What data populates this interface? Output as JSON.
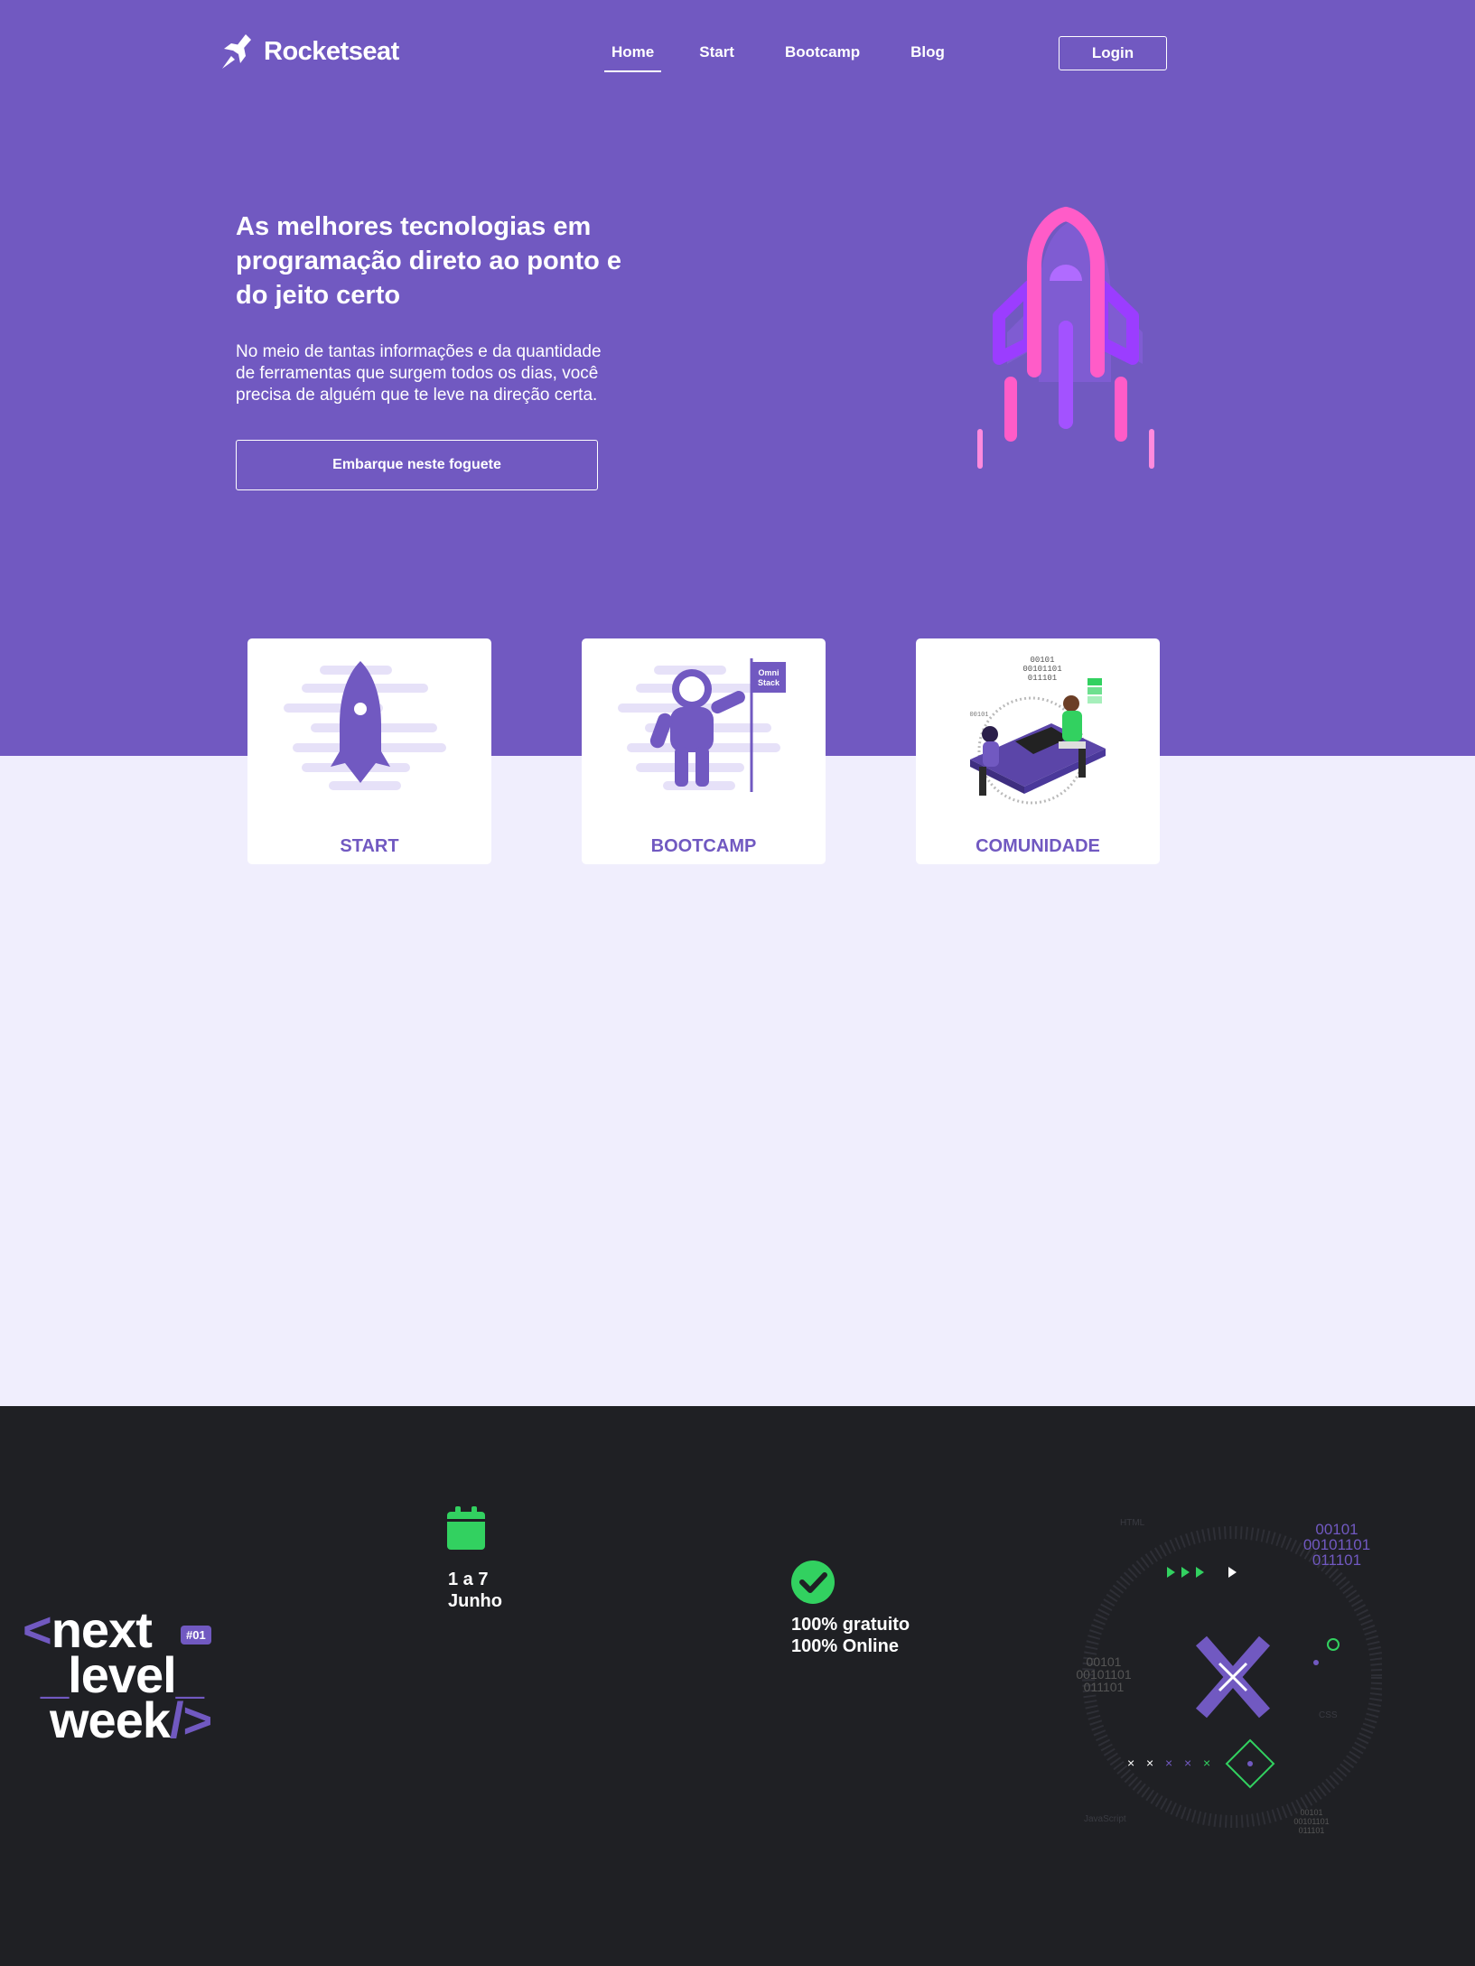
{
  "nav": {
    "brand": "Rocketseat",
    "links": [
      "Home",
      "Start",
      "Bootcamp",
      "Blog"
    ],
    "active": "Home",
    "login": "Login"
  },
  "hero": {
    "title": "As melhores tecnologias em programação direto ao ponto e do jeito certo",
    "text": "No meio de tantas informações e da quantidade de ferramentas que surgem todos os dias, você precisa de alguém que te leve na direção certa.",
    "cta": "Embarque neste foguete"
  },
  "cards": [
    {
      "label": "START"
    },
    {
      "label": "BOOTCAMP",
      "flag_text": "Omni Stack"
    },
    {
      "label": "COMUNIDADE",
      "binary": "00101 00101101 011101"
    }
  ],
  "event": {
    "logo_lines": [
      "next",
      "level",
      "week"
    ],
    "badge": "#01",
    "date_line1": "1 a 7",
    "date_line2": "Junho",
    "feature_line1": "100% gratuito",
    "feature_line2": "100% Online",
    "binary": "00101 00101101 011101",
    "labels": [
      "HTML",
      "CSS",
      "JavaScript"
    ]
  },
  "colors": {
    "brand_purple": "#7159C1",
    "page_lavender": "#F0EEFD",
    "dark": "#1F2024",
    "accent_green": "#32D160",
    "rocket_pink": "#FF5CC8",
    "rocket_violet": "#9B3DFF"
  }
}
